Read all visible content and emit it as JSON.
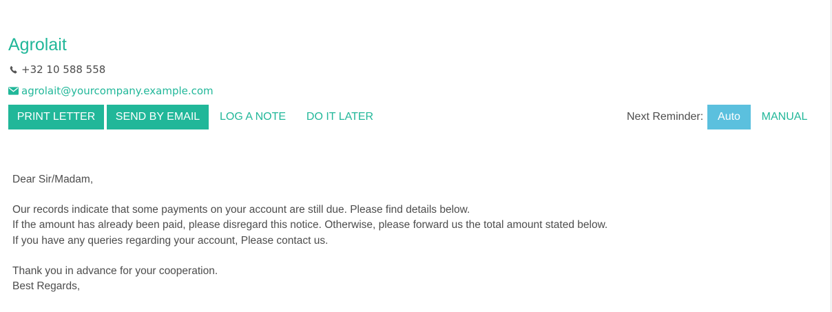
{
  "partner": {
    "name": "Agrolait",
    "phone": "+32 10 588 558",
    "email": "agrolait@yourcompany.example.com",
    "phone_icon": "phone-icon",
    "email_icon": "envelope-icon"
  },
  "actions": {
    "print_letter": "PRINT LETTER",
    "send_by_email": "SEND BY EMAIL",
    "log_a_note": "LOG A NOTE",
    "do_it_later": "DO IT LATER"
  },
  "reminder": {
    "label": "Next Reminder:",
    "auto": "Auto",
    "manual": "MANUAL"
  },
  "letter": {
    "greeting": "Dear Sir/Madam,",
    "body": [
      "Our records indicate that some payments on your account are still due. Please find details below.",
      "If the amount has already been paid, please disregard this notice. Otherwise, please forward us the total amount stated below.",
      "If you have any queries regarding your account, Please contact us."
    ],
    "closing": [
      "Thank you in advance for your cooperation.",
      "Best Regards,"
    ]
  },
  "colors": {
    "accent": "#21b799",
    "auto_button": "#5bc0de",
    "text": "#4c4c4c"
  }
}
